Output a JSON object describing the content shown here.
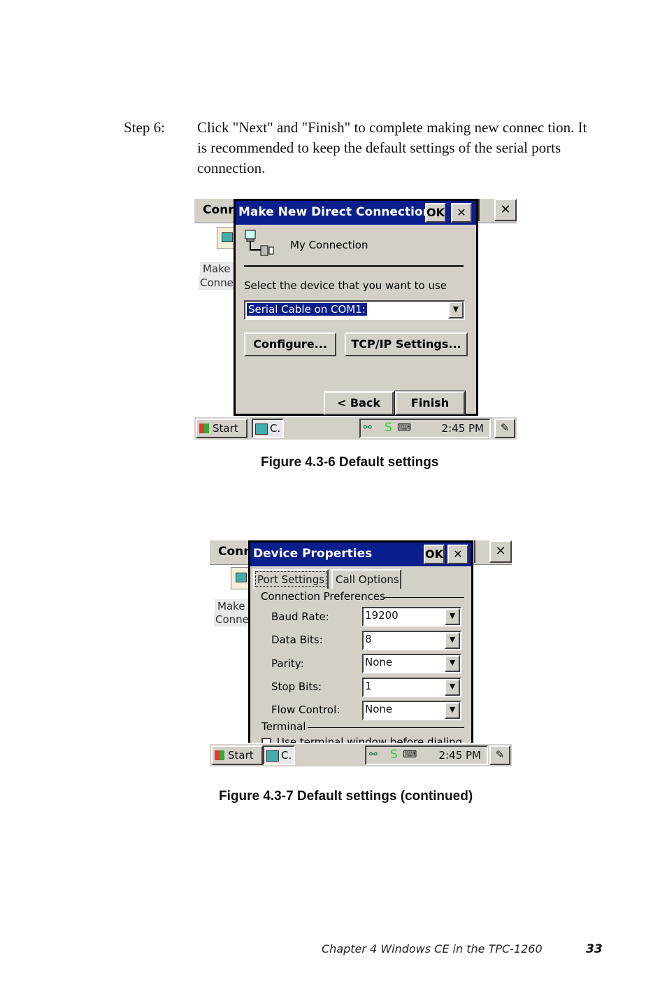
{
  "step": {
    "label": "Step 6:",
    "text": "Click \"Next\" and \"Finish\" to complete making new connec tion. It is recommended to keep the default settings of the serial ports connection."
  },
  "figure1": {
    "caption": "Figure 4.3-6  Default settings",
    "background_window": {
      "title": "Conr",
      "close": "✕",
      "desktop_label_1": "Make",
      "desktop_label_2": "Conne"
    },
    "dialog": {
      "title": "Make New Direct Connection",
      "ok_label": "OK",
      "close_label": "✕",
      "connection_name": "My Connection",
      "device_prompt": "Select the device that you want to use",
      "device_value": "Serial Cable on COM1:",
      "configure_label": "Configure...",
      "tcpip_label": "TCP/IP Settings...",
      "back_label": "< Back",
      "finish_label": "Finish"
    },
    "taskbar": {
      "start": "Start",
      "task": "C.",
      "tray_s": "S",
      "clock": "2:45 PM"
    }
  },
  "figure2": {
    "caption": "Figure 4.3-7  Default settings (continued)",
    "background_window": {
      "title": "Conr",
      "close": "✕",
      "desktop_label_1": "Make",
      "desktop_label_2": "Conne"
    },
    "dialog": {
      "title": "Device Properties",
      "ok_label": "OK",
      "close_label": "✕",
      "tabs": [
        "Port Settings",
        "Call Options"
      ],
      "group_label": "Connection Preferences",
      "fields": [
        {
          "label": "Baud Rate:",
          "value": "19200"
        },
        {
          "label": "Data Bits:",
          "value": "8"
        },
        {
          "label": "Parity:",
          "value": "None"
        },
        {
          "label": "Stop Bits:",
          "value": "1"
        },
        {
          "label": "Flow Control:",
          "value": "None"
        }
      ],
      "terminal_label": "Terminal",
      "terminal_option": "Use terminal window before dialing"
    },
    "taskbar": {
      "start": "Start",
      "task": "C.",
      "tray_s": "S",
      "clock": "2:45 PM"
    }
  },
  "footer": {
    "chapter": "Chapter 4   Windows CE in the TPC-1260",
    "page_number": "33"
  }
}
